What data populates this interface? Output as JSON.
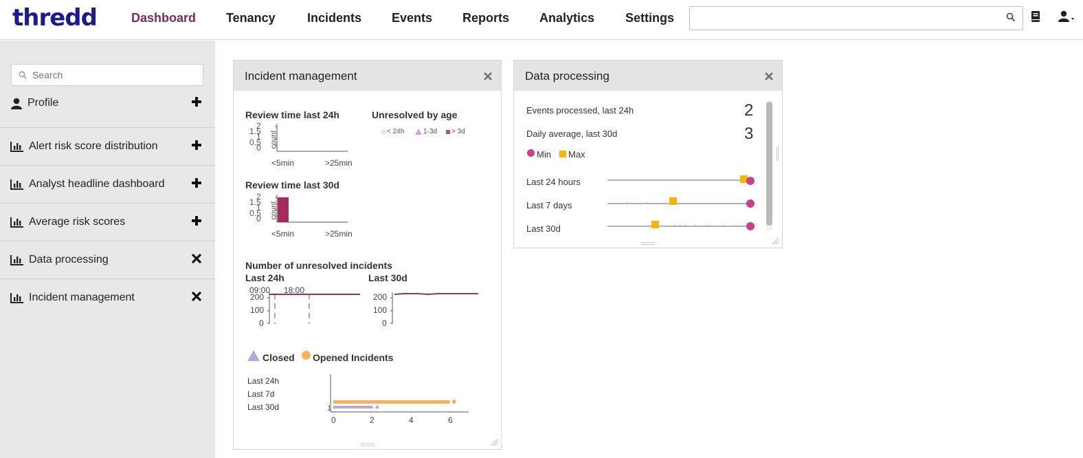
{
  "brand": {
    "logo_text": "thredd"
  },
  "nav": {
    "items": [
      {
        "label": "Dashboard"
      },
      {
        "label": "Tenancy"
      },
      {
        "label": "Incidents"
      },
      {
        "label": "Events"
      },
      {
        "label": "Reports"
      },
      {
        "label": "Analytics"
      },
      {
        "label": "Settings"
      }
    ],
    "search_value": "",
    "icons": [
      "search-icon",
      "book-icon",
      "user-menu-icon"
    ]
  },
  "sidebar": {
    "search_placeholder": "Search",
    "items": [
      {
        "label": "Profile",
        "icon": "user-icon",
        "action": "add"
      },
      {
        "label": "Alert risk score distribution",
        "icon": "bar-chart-icon",
        "action": "add"
      },
      {
        "label": "Analyst headline dashboard",
        "icon": "bar-chart-icon",
        "action": "add"
      },
      {
        "label": "Average risk scores",
        "icon": "bar-chart-icon",
        "action": "add"
      },
      {
        "label": "Data processing",
        "icon": "bar-chart-icon",
        "action": "remove"
      },
      {
        "label": "Incident management",
        "icon": "bar-chart-icon",
        "action": "remove"
      }
    ]
  },
  "incident_widget": {
    "title": "Incident management",
    "review24": {
      "title": "Review time last 24h",
      "y_label": "count",
      "y_ticks": [
        "2",
        "1.5",
        "1",
        "0.5",
        "0"
      ],
      "x_ticks": [
        "<5min",
        ">25min"
      ],
      "values": [
        0
      ]
    },
    "unresolved_age": {
      "title": "Unresolved by age",
      "legend": [
        "< 24h",
        "1-3d",
        "> 3d"
      ],
      "colors": [
        "#e5e5e5",
        "#c9a6d6",
        "#c44c91"
      ]
    },
    "review30": {
      "title": "Review time last 30d",
      "y_label": "count",
      "y_ticks": [
        "2",
        "1.5",
        "1",
        "0.5",
        "0"
      ],
      "x_ticks": [
        "<5min",
        ">25min"
      ],
      "values": [
        2
      ],
      "bar_color": "#a52a5e"
    },
    "unresolved": {
      "title": "Number of unresolved incidents",
      "last24": {
        "label": "Last 24h",
        "x_ticks": [
          "09:00",
          "18:00"
        ],
        "y_ticks": [
          "200",
          "100",
          "0"
        ],
        "value": 200
      },
      "last30": {
        "label": "Last 30d",
        "y_ticks": [
          "200",
          "100",
          "0"
        ],
        "value": 200
      },
      "line_color": "#a52a5e"
    },
    "closed_opened": {
      "legend_closed": "Closed",
      "legend_opened": "Opened Incidents",
      "closed_color": "#b8a8d8",
      "opened_color": "#f7b15e",
      "rows": [
        "Last 24h",
        "Last 7d",
        "Last 30d"
      ],
      "x_ticks": [
        "0",
        "2",
        "4",
        "6"
      ],
      "y_marker": "1",
      "opened_30d": 6.2,
      "closed_30d": 2.1
    }
  },
  "data_widget": {
    "title": "Data processing",
    "events_label": "Events processed, last 24h",
    "events_value": "2",
    "avg_label": "Daily average, last 30d",
    "avg_value": "3",
    "legend_min": "Min",
    "legend_max": "Max",
    "min_color": "#c6418a",
    "max_color": "#f5b50f",
    "rows": [
      {
        "label": "Last 24 hours"
      },
      {
        "label": "Last 7 days"
      },
      {
        "label": "Last 30d"
      }
    ]
  }
}
